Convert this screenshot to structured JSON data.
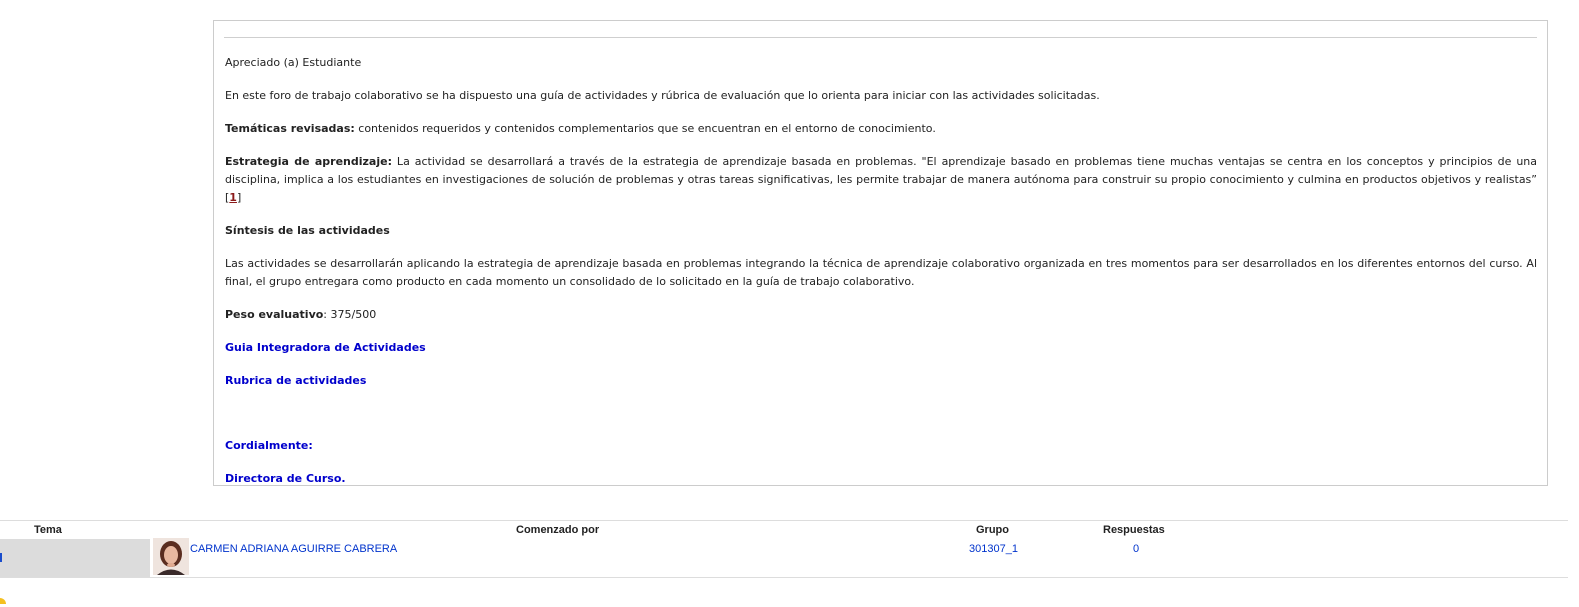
{
  "intro": {
    "greeting": "Apreciado (a) Estudiante",
    "paragraph1": "En este foro de trabajo colaborativo se ha dispuesto una guía de actividades y rúbrica de evaluación que lo orienta para iniciar con las actividades solicitadas.",
    "tematicas_label": "Temáticas revisadas:",
    "tematicas_text": " contenidos requeridos y contenidos complementarios que se encuentran en el entorno de conocimiento.",
    "estrategia_label": "Estrategia de aprendizaje:",
    "estrategia_text": " La actividad se desarrollará a través de la estrategia de aprendizaje basada en problemas. \"El aprendizaje basado en problemas tiene muchas ventajas se centra en los conceptos y principios de una disciplina, implica a los estudiantes en investigaciones de solución de problemas y otras tareas significativas, les permite trabajar de manera autónoma para construir su propio conocimiento y culmina en productos objetivos y realistas” [",
    "footnote_ref": "1",
    "footnote_close": "]",
    "sintesis_heading": "Síntesis de las actividades",
    "sintesis_text": "Las actividades se desarrollarán aplicando la estrategia de aprendizaje basada en problemas integrando la técnica de aprendizaje colaborativo organizada en tres momentos para ser desarrollados en los diferentes entornos del curso. Al final, el grupo entregara como producto en cada momento un consolidado de lo solicitado en la guía de trabajo colaborativo.",
    "peso_label": "Peso evaluativo",
    "peso_value": ": 375/500",
    "link_guia": "Guia Integradora de Actividades",
    "link_rubrica": "Rubrica de actividades",
    "sign_1": "Cordialmente:",
    "sign_2": "Directora de Curso."
  },
  "table": {
    "headers": {
      "tema": "Tema",
      "comenzado": "Comenzado por",
      "grupo": "Grupo",
      "respuestas": "Respuestas"
    },
    "rows": [
      {
        "tema": "",
        "author": "CARMEN ADRIANA AGUIRRE CABRERA",
        "grupo": "301307_1",
        "respuestas": "0"
      }
    ]
  },
  "icons": {
    "avatar": "user-photo-icon"
  },
  "colors": {
    "link": "#0000cc",
    "row_link": "#0033cc",
    "tema_cell_bg": "#dcdcdc"
  }
}
